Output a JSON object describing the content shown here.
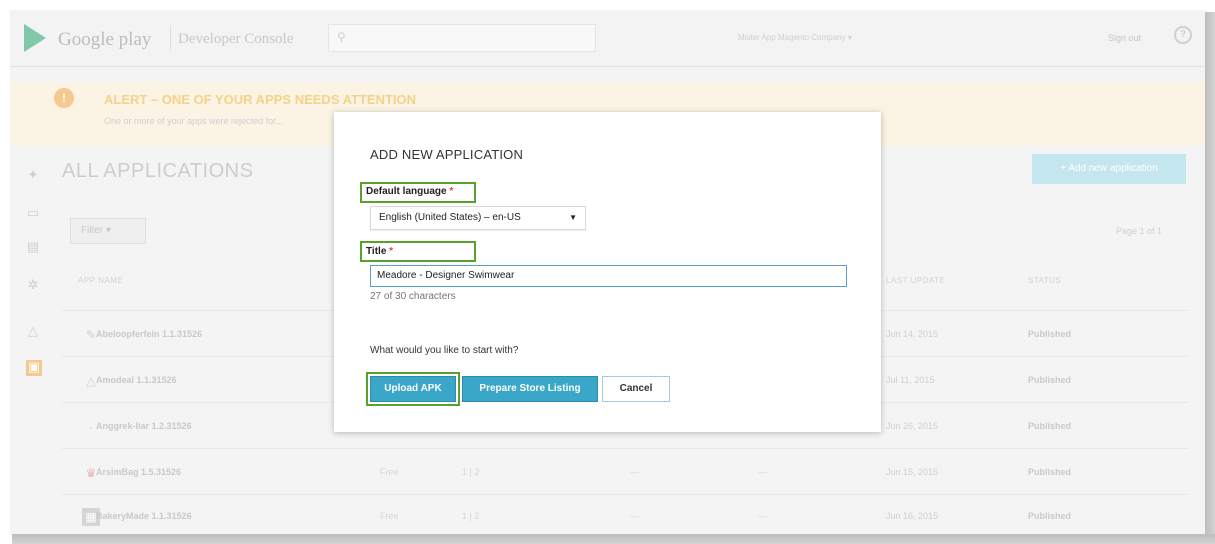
{
  "topbar": {
    "brand": "Google play",
    "console": "Developer Console",
    "search_icon": "search-icon",
    "account": "Mister App Magento Company ▾",
    "email": "",
    "signout": "Sign out",
    "help": "?"
  },
  "alert": {
    "icon": "!",
    "title": "ALERT – ONE OF YOUR APPS NEEDS ATTENTION",
    "desc": "One or more of your apps were rejected for..."
  },
  "main": {
    "heading": "ALL APPLICATIONS",
    "add_button": "+ Add new application",
    "filter": "Filter ▾",
    "page_info": "Page 1 of 1",
    "columns": {
      "name": "APP NAME",
      "last_update": "LAST UPDATE",
      "status": "STATUS"
    },
    "apps": [
      {
        "name": "Abeloopferfein 1.1.31526",
        "price": "",
        "count": "",
        "date": "Jun 14, 2015",
        "status": "Published",
        "icon": "app-icon"
      },
      {
        "name": "Amodeal 1.1.31526",
        "price": "",
        "count": "",
        "date": "Jul 11, 2015",
        "status": "Published",
        "icon": "app-icon"
      },
      {
        "name": "Anggrek-liar 1.2.31526",
        "price": "",
        "count": "",
        "date": "Jun 26, 2015",
        "status": "Published",
        "icon": "app-icon"
      },
      {
        "name": "ArsimBag 1.5.31526",
        "price": "Free",
        "count": "1 | 2",
        "date": "Jun 15, 2015",
        "status": "Published",
        "icon": "app-icon"
      },
      {
        "name": "BakeryMade 1.1.31526",
        "price": "Free",
        "count": "1 | 2",
        "date": "Jun 16, 2015",
        "status": "Published",
        "icon": "app-icon"
      }
    ],
    "dash": "—"
  },
  "modal": {
    "title": "ADD NEW APPLICATION",
    "language_label": "Default language",
    "language_value": "English (United States) – en-US",
    "title_label": "Title",
    "required_mark": "*",
    "title_value": "Meadore - Designer Swimwear",
    "char_count": "27 of 30 characters",
    "question": "What would you like to start with?",
    "upload_button": "Upload APK",
    "listing_button": "Prepare Store Listing",
    "cancel_button": "Cancel",
    "dropdown_arrow": "▼"
  },
  "colors": {
    "highlight": "#5aa02c",
    "primary": "#3aa7c9",
    "required": "#e0463a"
  }
}
